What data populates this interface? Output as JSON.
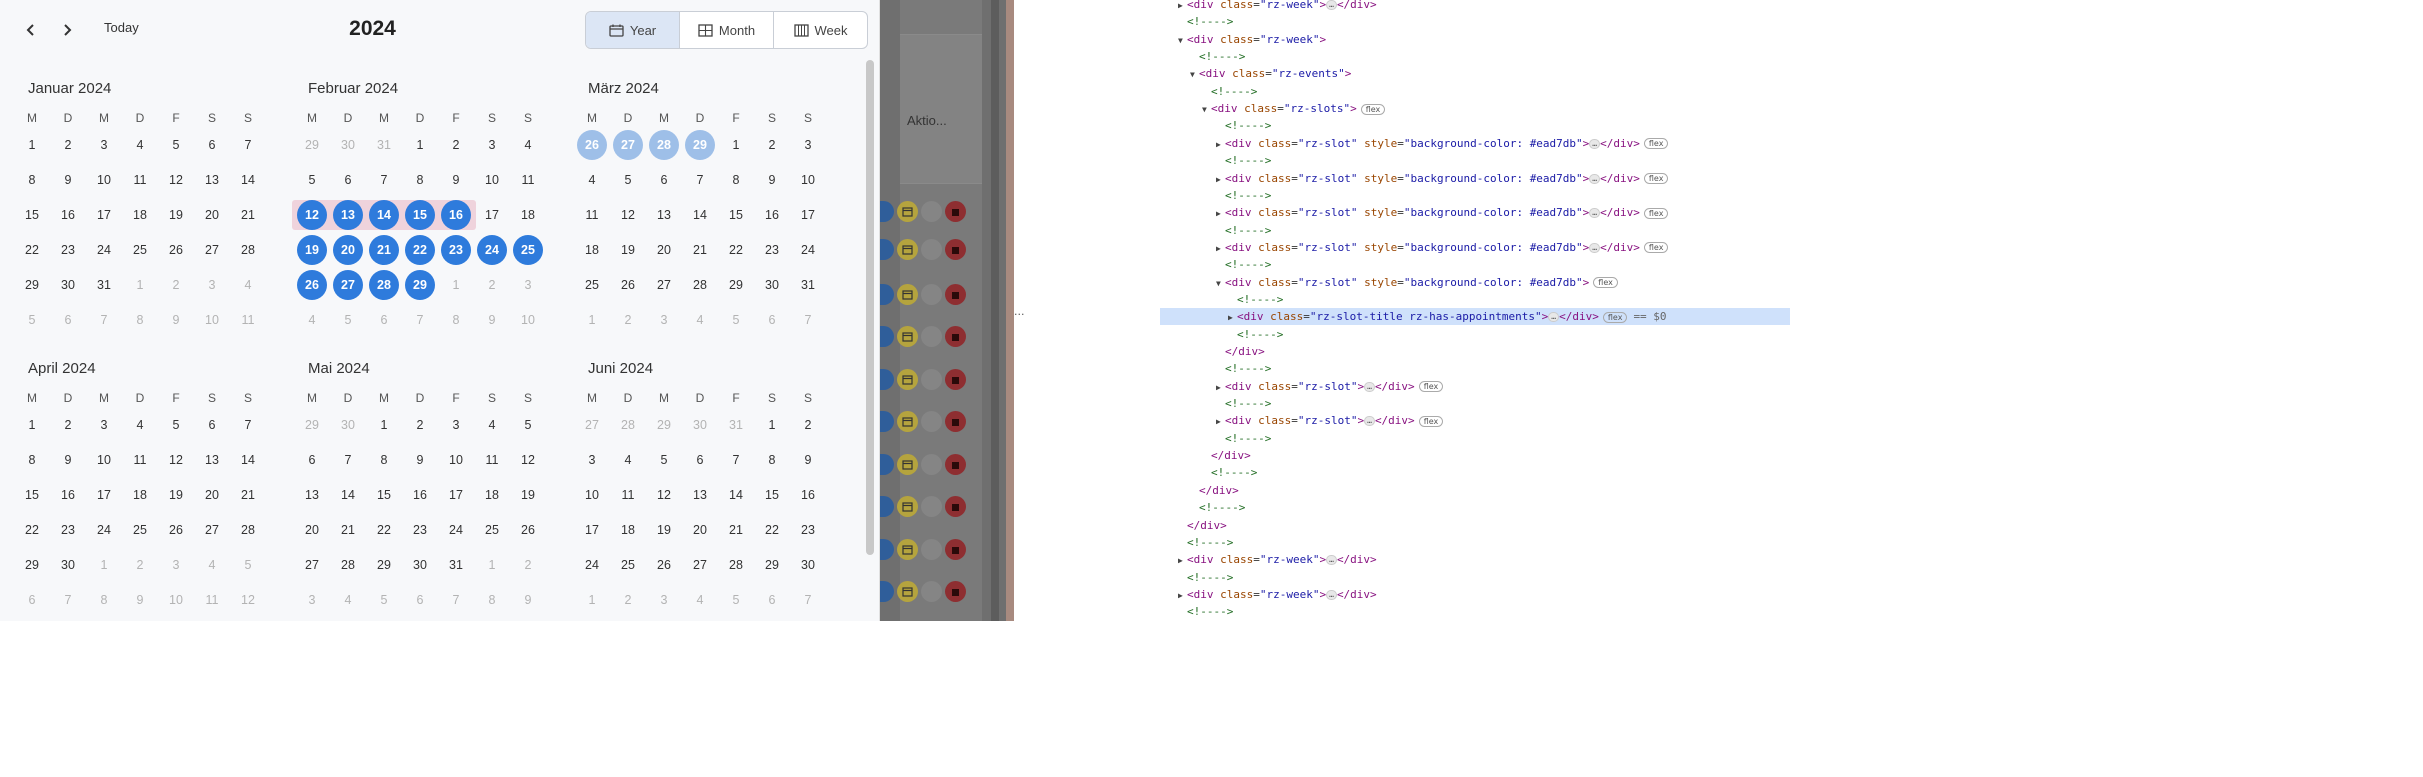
{
  "toolbar": {
    "today_label": "Today",
    "year_title": "2024",
    "views": [
      {
        "label": "Year",
        "icon": "calendar-icon",
        "active": true
      },
      {
        "label": "Month",
        "icon": "grid-icon",
        "active": false
      },
      {
        "label": "Week",
        "icon": "week-grid-icon",
        "active": false
      }
    ]
  },
  "weekdays": [
    "M",
    "D",
    "M",
    "D",
    "F",
    "S",
    "S"
  ],
  "months": [
    {
      "title": "Januar 2024",
      "lead": [],
      "days": 31,
      "trail": [
        1,
        2,
        3,
        4,
        5,
        6,
        7,
        8,
        9,
        10,
        11
      ],
      "selected": [],
      "highlighted": []
    },
    {
      "title": "Februar 2024",
      "lead": [
        29,
        30,
        31
      ],
      "days": 29,
      "trail": [
        1,
        2,
        3,
        4,
        5,
        6,
        7,
        8,
        9,
        10
      ],
      "selected": [
        12,
        13,
        14,
        15,
        16,
        19,
        20,
        21,
        22,
        23,
        24,
        25,
        26,
        27,
        28,
        29
      ],
      "highlighted": [],
      "band": [
        12,
        16
      ]
    },
    {
      "title": "März 2024",
      "lead": [
        26,
        27,
        28,
        29
      ],
      "days": 31,
      "trail": [
        1,
        2,
        3,
        4,
        5,
        6,
        7
      ],
      "selected": [],
      "highlighted_lead": [
        26,
        27,
        28,
        29
      ],
      "highlighted": []
    },
    {
      "title": "April 2024",
      "lead": [],
      "days": 30,
      "trail": [
        1,
        2,
        3,
        4,
        5,
        6,
        7,
        8,
        9,
        10,
        11,
        12
      ],
      "selected": [],
      "highlighted": []
    },
    {
      "title": "Mai 2024",
      "lead": [
        29,
        30
      ],
      "days": 31,
      "trail": [
        1,
        2,
        3,
        4,
        5,
        6,
        7,
        8,
        9
      ],
      "selected": [],
      "highlighted": []
    },
    {
      "title": "Juni 2024",
      "lead": [
        27,
        28,
        29,
        30,
        31
      ],
      "days": 30,
      "trail": [
        1,
        2,
        3,
        4,
        5,
        6,
        7
      ],
      "selected": [],
      "highlighted": []
    }
  ],
  "middle": {
    "aktio_label": "Aktio..."
  },
  "devtools": {
    "lines": [
      {
        "indent": 0,
        "tri": "▶",
        "parts": [
          [
            "t",
            "<div "
          ],
          [
            "a",
            "class"
          ],
          [
            "p",
            "="
          ],
          [
            "v",
            "\"rz-week\""
          ],
          [
            "t",
            ">"
          ],
          [
            "ell",
            ""
          ],
          [
            "t",
            "</div>"
          ]
        ]
      },
      {
        "indent": 0,
        "tri": "",
        "parts": [
          [
            "c",
            "<!---->"
          ]
        ]
      },
      {
        "indent": 0,
        "tri": "▼",
        "parts": [
          [
            "t",
            "<div "
          ],
          [
            "a",
            "class"
          ],
          [
            "p",
            "="
          ],
          [
            "v",
            "\"rz-week\""
          ],
          [
            "t",
            ">"
          ]
        ]
      },
      {
        "indent": 1,
        "tri": "",
        "parts": [
          [
            "c",
            "<!---->"
          ]
        ]
      },
      {
        "indent": 1,
        "tri": "▼",
        "parts": [
          [
            "t",
            "<div "
          ],
          [
            "a",
            "class"
          ],
          [
            "p",
            "="
          ],
          [
            "v",
            "\"rz-events\""
          ],
          [
            "t",
            ">"
          ]
        ]
      },
      {
        "indent": 2,
        "tri": "",
        "parts": [
          [
            "c",
            "<!---->"
          ]
        ]
      },
      {
        "indent": 2,
        "tri": "▼",
        "parts": [
          [
            "t",
            "<div "
          ],
          [
            "a",
            "class"
          ],
          [
            "p",
            "="
          ],
          [
            "v",
            "\"rz-slots\""
          ],
          [
            "t",
            ">"
          ],
          [
            "pill",
            "flex"
          ]
        ]
      },
      {
        "indent": 3,
        "tri": "",
        "parts": [
          [
            "c",
            "<!---->"
          ]
        ]
      },
      {
        "indent": 3,
        "tri": "▶",
        "parts": [
          [
            "t",
            "<div "
          ],
          [
            "a",
            "class"
          ],
          [
            "p",
            "="
          ],
          [
            "v",
            "\"rz-slot\""
          ],
          [
            "p",
            " "
          ],
          [
            "a",
            "style"
          ],
          [
            "p",
            "="
          ],
          [
            "v",
            "\"background-color: #ead7db\""
          ],
          [
            "t",
            ">"
          ],
          [
            "ell",
            ""
          ],
          [
            "t",
            "</div>"
          ],
          [
            "pill",
            "flex"
          ]
        ]
      },
      {
        "indent": 3,
        "tri": "",
        "parts": [
          [
            "c",
            "<!---->"
          ]
        ]
      },
      {
        "indent": 3,
        "tri": "▶",
        "parts": [
          [
            "t",
            "<div "
          ],
          [
            "a",
            "class"
          ],
          [
            "p",
            "="
          ],
          [
            "v",
            "\"rz-slot\""
          ],
          [
            "p",
            " "
          ],
          [
            "a",
            "style"
          ],
          [
            "p",
            "="
          ],
          [
            "v",
            "\"background-color: #ead7db\""
          ],
          [
            "t",
            ">"
          ],
          [
            "ell",
            ""
          ],
          [
            "t",
            "</div>"
          ],
          [
            "pill",
            "flex"
          ]
        ]
      },
      {
        "indent": 3,
        "tri": "",
        "parts": [
          [
            "c",
            "<!---->"
          ]
        ]
      },
      {
        "indent": 3,
        "tri": "▶",
        "parts": [
          [
            "t",
            "<div "
          ],
          [
            "a",
            "class"
          ],
          [
            "p",
            "="
          ],
          [
            "v",
            "\"rz-slot\""
          ],
          [
            "p",
            " "
          ],
          [
            "a",
            "style"
          ],
          [
            "p",
            "="
          ],
          [
            "v",
            "\"background-color: #ead7db\""
          ],
          [
            "t",
            ">"
          ],
          [
            "ell",
            ""
          ],
          [
            "t",
            "</div>"
          ],
          [
            "pill",
            "flex"
          ]
        ]
      },
      {
        "indent": 3,
        "tri": "",
        "parts": [
          [
            "c",
            "<!---->"
          ]
        ]
      },
      {
        "indent": 3,
        "tri": "▶",
        "parts": [
          [
            "t",
            "<div "
          ],
          [
            "a",
            "class"
          ],
          [
            "p",
            "="
          ],
          [
            "v",
            "\"rz-slot\""
          ],
          [
            "p",
            " "
          ],
          [
            "a",
            "style"
          ],
          [
            "p",
            "="
          ],
          [
            "v",
            "\"background-color: #ead7db\""
          ],
          [
            "t",
            ">"
          ],
          [
            "ell",
            ""
          ],
          [
            "t",
            "</div>"
          ],
          [
            "pill",
            "flex"
          ]
        ]
      },
      {
        "indent": 3,
        "tri": "",
        "parts": [
          [
            "c",
            "<!---->"
          ]
        ]
      },
      {
        "indent": 3,
        "tri": "▼",
        "parts": [
          [
            "t",
            "<div "
          ],
          [
            "a",
            "class"
          ],
          [
            "p",
            "="
          ],
          [
            "v",
            "\"rz-slot\""
          ],
          [
            "p",
            " "
          ],
          [
            "a",
            "style"
          ],
          [
            "p",
            "="
          ],
          [
            "v",
            "\"background-color: #ead7db\""
          ],
          [
            "t",
            ">"
          ],
          [
            "pill",
            "flex"
          ]
        ]
      },
      {
        "indent": 4,
        "tri": "",
        "parts": [
          [
            "c",
            "<!---->"
          ]
        ]
      },
      {
        "indent": 4,
        "tri": "▶",
        "selected": true,
        "parts": [
          [
            "t",
            "<div "
          ],
          [
            "a",
            "class"
          ],
          [
            "p",
            "="
          ],
          [
            "v",
            "\"rz-slot-title  rz-has-appointments\""
          ],
          [
            "t",
            ">"
          ],
          [
            "ell",
            ""
          ],
          [
            "t",
            "</div>"
          ],
          [
            "pill",
            "flex"
          ],
          [
            "dollar",
            "== $0"
          ]
        ]
      },
      {
        "indent": 4,
        "tri": "",
        "parts": [
          [
            "c",
            "<!---->"
          ]
        ]
      },
      {
        "indent": 3,
        "tri": "",
        "parts": [
          [
            "t",
            "</div>"
          ]
        ]
      },
      {
        "indent": 3,
        "tri": "",
        "parts": [
          [
            "c",
            "<!---->"
          ]
        ]
      },
      {
        "indent": 3,
        "tri": "▶",
        "parts": [
          [
            "t",
            "<div "
          ],
          [
            "a",
            "class"
          ],
          [
            "p",
            "="
          ],
          [
            "v",
            "\"rz-slot\""
          ],
          [
            "t",
            ">"
          ],
          [
            "ell",
            ""
          ],
          [
            "t",
            "</div>"
          ],
          [
            "pill",
            "flex"
          ]
        ]
      },
      {
        "indent": 3,
        "tri": "",
        "parts": [
          [
            "c",
            "<!---->"
          ]
        ]
      },
      {
        "indent": 3,
        "tri": "▶",
        "parts": [
          [
            "t",
            "<div "
          ],
          [
            "a",
            "class"
          ],
          [
            "p",
            "="
          ],
          [
            "v",
            "\"rz-slot\""
          ],
          [
            "t",
            ">"
          ],
          [
            "ell",
            ""
          ],
          [
            "t",
            "</div>"
          ],
          [
            "pill",
            "flex"
          ]
        ]
      },
      {
        "indent": 3,
        "tri": "",
        "parts": [
          [
            "c",
            "<!---->"
          ]
        ]
      },
      {
        "indent": 2,
        "tri": "",
        "parts": [
          [
            "t",
            "</div>"
          ]
        ]
      },
      {
        "indent": 2,
        "tri": "",
        "parts": [
          [
            "c",
            "<!---->"
          ]
        ]
      },
      {
        "indent": 1,
        "tri": "",
        "parts": [
          [
            "t",
            "</div>"
          ]
        ]
      },
      {
        "indent": 1,
        "tri": "",
        "parts": [
          [
            "c",
            "<!---->"
          ]
        ]
      },
      {
        "indent": 0,
        "tri": "",
        "parts": [
          [
            "t",
            "</div>"
          ]
        ]
      },
      {
        "indent": 0,
        "tri": "",
        "parts": [
          [
            "c",
            "<!---->"
          ]
        ]
      },
      {
        "indent": 0,
        "tri": "▶",
        "parts": [
          [
            "t",
            "<div "
          ],
          [
            "a",
            "class"
          ],
          [
            "p",
            "="
          ],
          [
            "v",
            "\"rz-week\""
          ],
          [
            "t",
            ">"
          ],
          [
            "ell",
            ""
          ],
          [
            "t",
            "</div>"
          ]
        ]
      },
      {
        "indent": 0,
        "tri": "",
        "parts": [
          [
            "c",
            "<!---->"
          ]
        ]
      },
      {
        "indent": 0,
        "tri": "▶",
        "parts": [
          [
            "t",
            "<div "
          ],
          [
            "a",
            "class"
          ],
          [
            "p",
            "="
          ],
          [
            "v",
            "\"rz-week\""
          ],
          [
            "t",
            ">"
          ],
          [
            "ell",
            ""
          ],
          [
            "t",
            "</div>"
          ]
        ]
      },
      {
        "indent": 0,
        "tri": "",
        "parts": [
          [
            "c",
            "<!---->"
          ]
        ]
      }
    ]
  },
  "colors": {
    "selected": "#2e7bdc",
    "highlight": "#9ebfe8",
    "band": "#efd3dc",
    "active_view": "#dce6f5"
  }
}
